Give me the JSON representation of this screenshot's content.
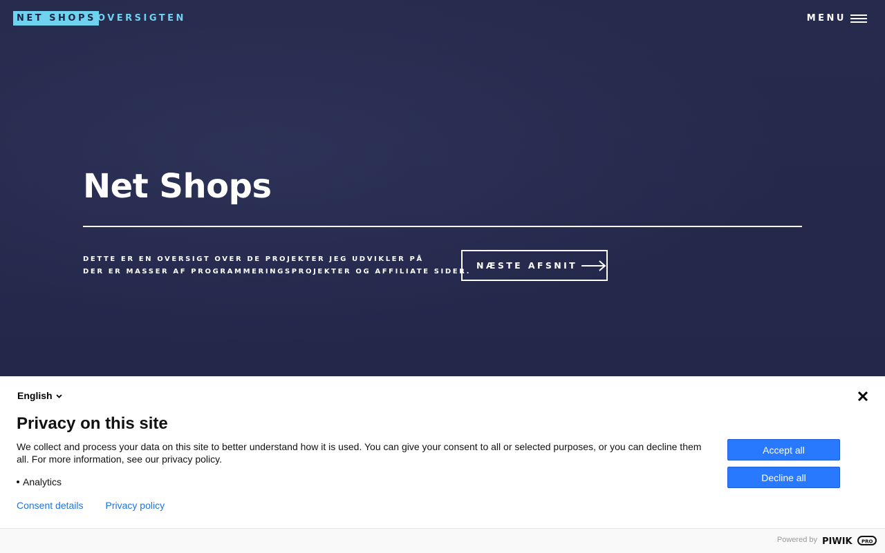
{
  "header": {
    "logo_primary": "NET SHOPS",
    "logo_secondary": "OVERSIGTEN",
    "menu_label": "MENU"
  },
  "hero": {
    "title": "Net Shops",
    "description_lines": [
      "DETTE ER EN OVERSIGT OVER DE PROJEKTER JEG UDVIKLER PÅ",
      "DER ER MASSER AF PROGRAMMERINGSPROJEKTER OG AFFILIATE SIDER."
    ],
    "next_button_label": "NÆSTE AFSNIT"
  },
  "consent": {
    "language": "English",
    "title": "Privacy on this site",
    "body": "We collect and process your data on this site to better understand how it is used. You can give your consent to all or selected purposes, or you can decline them all. For more information, see our privacy policy.",
    "purposes": [
      "Analytics"
    ],
    "links": {
      "consent_details": "Consent details",
      "privacy_policy": "Privacy policy"
    },
    "accept_label": "Accept all",
    "decline_label": "Decline all",
    "powered_by": "Powered by",
    "brand_logo": "PIWIK PRO"
  },
  "colors": {
    "hero_background": "#25294a",
    "logo_accent": "#6fd3ef",
    "button_primary": "#2979ff",
    "link": "#1a73e8"
  }
}
